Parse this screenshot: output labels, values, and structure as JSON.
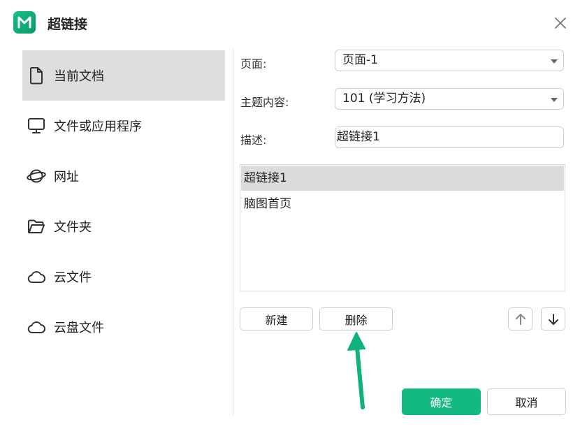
{
  "window": {
    "title": "超链接"
  },
  "sidebar": {
    "items": [
      {
        "label": "当前文档",
        "icon": "document-icon",
        "active": true
      },
      {
        "label": "文件或应用程序",
        "icon": "monitor-icon",
        "active": false
      },
      {
        "label": "网址",
        "icon": "globe-icon",
        "active": false
      },
      {
        "label": "文件夹",
        "icon": "folder-icon",
        "active": false
      },
      {
        "label": "云文件",
        "icon": "cloud-icon",
        "active": false
      },
      {
        "label": "云盘文件",
        "icon": "cloud-drive-icon",
        "active": false
      }
    ]
  },
  "form": {
    "page_label": "页面:",
    "page_value": "页面-1",
    "topic_label": "主题内容:",
    "topic_value": "101 (学习方法)",
    "desc_label": "描述:",
    "desc_value": "超链接1"
  },
  "list": {
    "items": [
      {
        "label": "超链接1",
        "selected": true
      },
      {
        "label": "脑图首页",
        "selected": false
      }
    ]
  },
  "buttons": {
    "new_label": "新建",
    "delete_label": "删除",
    "ok_label": "确定",
    "cancel_label": "取消"
  },
  "colors": {
    "accent": "#14b883",
    "annotation_arrow": "#12b27e",
    "selected_bg": "#dcdcdc"
  }
}
